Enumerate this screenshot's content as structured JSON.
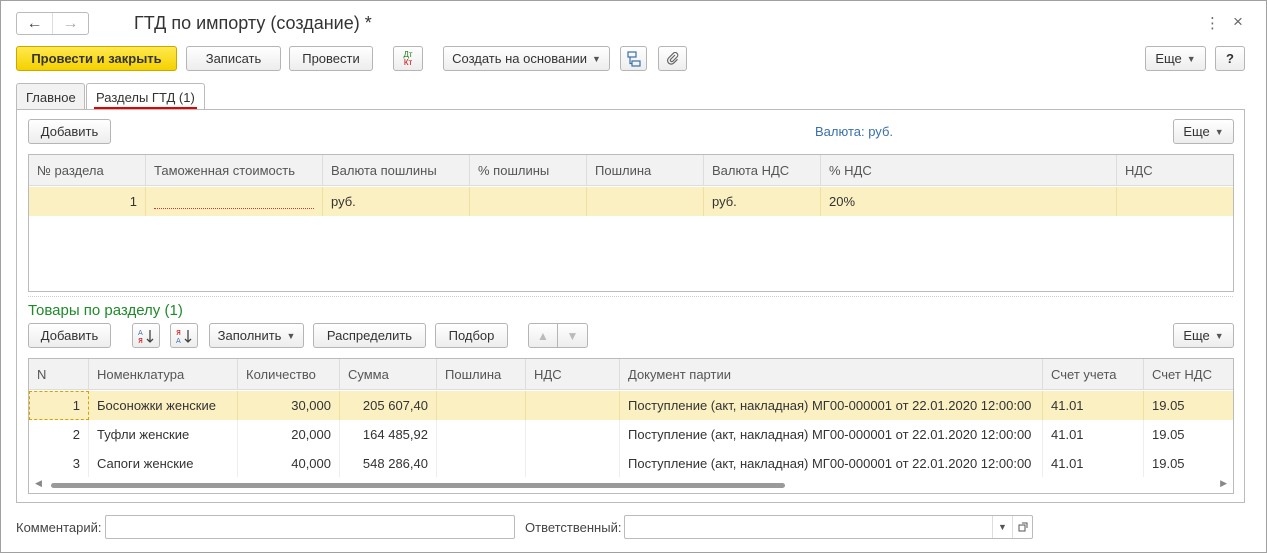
{
  "window": {
    "title": "ГТД по импорту (создание) *",
    "nav_back": "←",
    "nav_forward": "→",
    "more_icon": "⋮",
    "close_icon": "×"
  },
  "toolbar": {
    "post_close": "Провести и закрыть",
    "save": "Записать",
    "post": "Провести",
    "dt_kt": "Дт Кт",
    "create_based": "Создать на основании",
    "more": "Еще",
    "help": "?"
  },
  "tabs": [
    {
      "label": "Главное"
    },
    {
      "label": "Разделы ГТД (1)"
    }
  ],
  "sections": {
    "add": "Добавить",
    "currency_label": "Валюта: руб.",
    "more": "Еще",
    "columns": [
      "№ раздела",
      "Таможенная стоимость",
      "Валюта пошлины",
      "% пошлины",
      "Пошлина",
      "Валюта НДС",
      "% НДС",
      "НДС"
    ],
    "rows": [
      {
        "num": "1",
        "customs_value": "",
        "duty_currency": "руб.",
        "duty_pct": "",
        "duty": "",
        "vat_currency": "руб.",
        "vat_pct": "20%",
        "vat": ""
      }
    ]
  },
  "goods": {
    "title": "Товары по разделу (1)",
    "add": "Добавить",
    "fill": "Заполнить",
    "distribute": "Распределить",
    "pick": "Подбор",
    "more": "Еще",
    "columns": [
      "N",
      "Номенклатура",
      "Количество",
      "Сумма",
      "Пошлина",
      "НДС",
      "Документ партии",
      "Счет учета",
      "Счет НДС"
    ],
    "rows": [
      {
        "n": "1",
        "item": "Босоножки женские",
        "qty": "30,000",
        "sum": "205 607,40",
        "duty": "",
        "vat": "",
        "doc": "Поступление (акт, накладная) МГ00-000001 от 22.01.2020 12:00:00",
        "account": "41.01",
        "vat_account": "19.05"
      },
      {
        "n": "2",
        "item": "Туфли женские",
        "qty": "20,000",
        "sum": "164 485,92",
        "duty": "",
        "vat": "",
        "doc": "Поступление (акт, накладная) МГ00-000001 от 22.01.2020 12:00:00",
        "account": "41.01",
        "vat_account": "19.05"
      },
      {
        "n": "3",
        "item": "Сапоги женские",
        "qty": "40,000",
        "sum": "548 286,40",
        "duty": "",
        "vat": "",
        "doc": "Поступление (акт, накладная) МГ00-000001 от 22.01.2020 12:00:00",
        "account": "41.01",
        "vat_account": "19.05"
      }
    ]
  },
  "footer": {
    "comment_label": "Комментарий:",
    "comment_value": "",
    "responsible_label": "Ответственный:",
    "responsible_value": ""
  }
}
